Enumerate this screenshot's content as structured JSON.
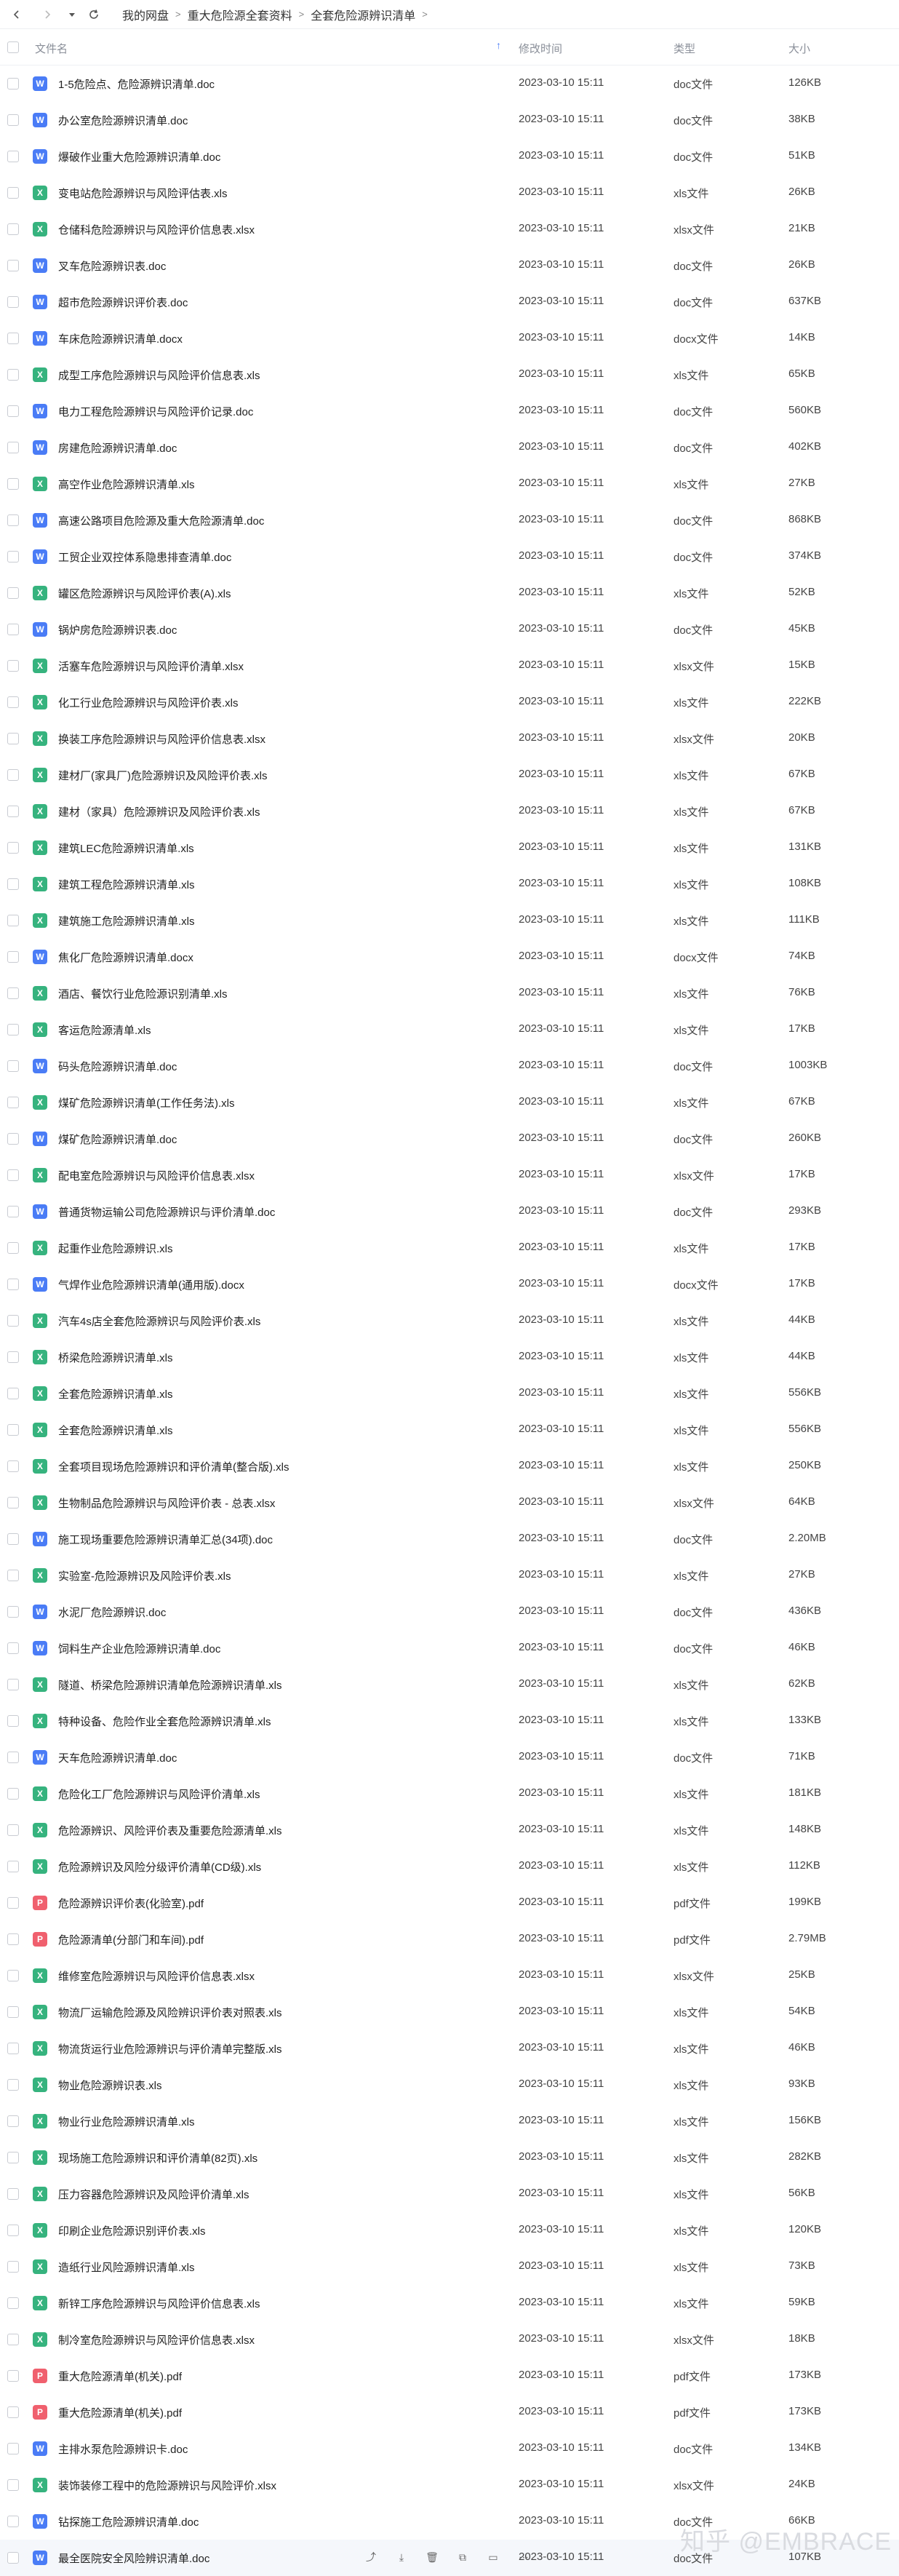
{
  "toolbar": {
    "back_icon": "chevron-left-icon",
    "forward_icon": "chevron-right-icon",
    "history_icon": "chevron-down-icon",
    "refresh_icon": "refresh-icon"
  },
  "breadcrumb": [
    "我的网盘",
    "重大危险源全套资料",
    "全套危险源辨识清单"
  ],
  "header": {
    "name": "文件名",
    "modified": "修改时间",
    "type": "类型",
    "size": "大小"
  },
  "watermark": "知乎 @EMBRACE",
  "row_action_icons": [
    "share-icon",
    "download-icon",
    "delete-icon",
    "copy-icon",
    "move-icon",
    "more-icon"
  ],
  "hovered_row": 68,
  "files": [
    {
      "name": "1-5危险点、危险源辨识清单.doc",
      "time": "2023-03-10 15:11",
      "type": "doc文件",
      "size": "126KB",
      "kind": "doc"
    },
    {
      "name": "办公室危险源辨识清单.doc",
      "time": "2023-03-10 15:11",
      "type": "doc文件",
      "size": "38KB",
      "kind": "doc"
    },
    {
      "name": "爆破作业重大危险源辨识清单.doc",
      "time": "2023-03-10 15:11",
      "type": "doc文件",
      "size": "51KB",
      "kind": "doc"
    },
    {
      "name": "变电站危险源辨识与风险评估表.xls",
      "time": "2023-03-10 15:11",
      "type": "xls文件",
      "size": "26KB",
      "kind": "xls"
    },
    {
      "name": "仓储科危险源辨识与风险评价信息表.xlsx",
      "time": "2023-03-10 15:11",
      "type": "xlsx文件",
      "size": "21KB",
      "kind": "xls"
    },
    {
      "name": "叉车危险源辨识表.doc",
      "time": "2023-03-10 15:11",
      "type": "doc文件",
      "size": "26KB",
      "kind": "doc"
    },
    {
      "name": "超市危险源辨识评价表.doc",
      "time": "2023-03-10 15:11",
      "type": "doc文件",
      "size": "637KB",
      "kind": "doc"
    },
    {
      "name": "车床危险源辨识清单.docx",
      "time": "2023-03-10 15:11",
      "type": "docx文件",
      "size": "14KB",
      "kind": "doc"
    },
    {
      "name": "成型工序危险源辨识与风险评价信息表.xls",
      "time": "2023-03-10 15:11",
      "type": "xls文件",
      "size": "65KB",
      "kind": "xls"
    },
    {
      "name": "电力工程危险源辨识与风险评价记录.doc",
      "time": "2023-03-10 15:11",
      "type": "doc文件",
      "size": "560KB",
      "kind": "doc"
    },
    {
      "name": "房建危险源辨识清单.doc",
      "time": "2023-03-10 15:11",
      "type": "doc文件",
      "size": "402KB",
      "kind": "doc"
    },
    {
      "name": "高空作业危险源辨识清单.xls",
      "time": "2023-03-10 15:11",
      "type": "xls文件",
      "size": "27KB",
      "kind": "xls"
    },
    {
      "name": "高速公路项目危险源及重大危险源清单.doc",
      "time": "2023-03-10 15:11",
      "type": "doc文件",
      "size": "868KB",
      "kind": "doc"
    },
    {
      "name": "工贸企业双控体系隐患排查清单.doc",
      "time": "2023-03-10 15:11",
      "type": "doc文件",
      "size": "374KB",
      "kind": "doc"
    },
    {
      "name": "罐区危险源辨识与风险评价表(A).xls",
      "time": "2023-03-10 15:11",
      "type": "xls文件",
      "size": "52KB",
      "kind": "xls"
    },
    {
      "name": "锅炉房危险源辨识表.doc",
      "time": "2023-03-10 15:11",
      "type": "doc文件",
      "size": "45KB",
      "kind": "doc"
    },
    {
      "name": "活塞车危险源辨识与风险评价清单.xlsx",
      "time": "2023-03-10 15:11",
      "type": "xlsx文件",
      "size": "15KB",
      "kind": "xls"
    },
    {
      "name": "化工行业危险源辨识与风险评价表.xls",
      "time": "2023-03-10 15:11",
      "type": "xls文件",
      "size": "222KB",
      "kind": "xls"
    },
    {
      "name": "换装工序危险源辨识与风险评价信息表.xlsx",
      "time": "2023-03-10 15:11",
      "type": "xlsx文件",
      "size": "20KB",
      "kind": "xls"
    },
    {
      "name": "建材厂(家具厂)危险源辨识及风险评价表.xls",
      "time": "2023-03-10 15:11",
      "type": "xls文件",
      "size": "67KB",
      "kind": "xls"
    },
    {
      "name": "建材（家具）危险源辨识及风险评价表.xls",
      "time": "2023-03-10 15:11",
      "type": "xls文件",
      "size": "67KB",
      "kind": "xls"
    },
    {
      "name": "建筑LEC危险源辨识清单.xls",
      "time": "2023-03-10 15:11",
      "type": "xls文件",
      "size": "131KB",
      "kind": "xls"
    },
    {
      "name": "建筑工程危险源辨识清单.xls",
      "time": "2023-03-10 15:11",
      "type": "xls文件",
      "size": "108KB",
      "kind": "xls"
    },
    {
      "name": "建筑施工危险源辨识清单.xls",
      "time": "2023-03-10 15:11",
      "type": "xls文件",
      "size": "111KB",
      "kind": "xls"
    },
    {
      "name": "焦化厂危险源辨识清单.docx",
      "time": "2023-03-10 15:11",
      "type": "docx文件",
      "size": "74KB",
      "kind": "doc"
    },
    {
      "name": "酒店、餐饮行业危险源识别清单.xls",
      "time": "2023-03-10 15:11",
      "type": "xls文件",
      "size": "76KB",
      "kind": "xls"
    },
    {
      "name": "客运危险源清单.xls",
      "time": "2023-03-10 15:11",
      "type": "xls文件",
      "size": "17KB",
      "kind": "xls"
    },
    {
      "name": "码头危险源辨识清单.doc",
      "time": "2023-03-10 15:11",
      "type": "doc文件",
      "size": "1003KB",
      "kind": "doc"
    },
    {
      "name": "煤矿危险源辨识清单(工作任务法).xls",
      "time": "2023-03-10 15:11",
      "type": "xls文件",
      "size": "67KB",
      "kind": "xls"
    },
    {
      "name": "煤矿危险源辨识清单.doc",
      "time": "2023-03-10 15:11",
      "type": "doc文件",
      "size": "260KB",
      "kind": "doc"
    },
    {
      "name": "配电室危险源辨识与风险评价信息表.xlsx",
      "time": "2023-03-10 15:11",
      "type": "xlsx文件",
      "size": "17KB",
      "kind": "xls"
    },
    {
      "name": "普通货物运输公司危险源辨识与评价清单.doc",
      "time": "2023-03-10 15:11",
      "type": "doc文件",
      "size": "293KB",
      "kind": "doc"
    },
    {
      "name": "起重作业危险源辨识.xls",
      "time": "2023-03-10 15:11",
      "type": "xls文件",
      "size": "17KB",
      "kind": "xls"
    },
    {
      "name": "气焊作业危险源辨识清单(通用版).docx",
      "time": "2023-03-10 15:11",
      "type": "docx文件",
      "size": "17KB",
      "kind": "doc"
    },
    {
      "name": "汽车4s店全套危险源辨识与风险评价表.xls",
      "time": "2023-03-10 15:11",
      "type": "xls文件",
      "size": "44KB",
      "kind": "xls"
    },
    {
      "name": "桥梁危险源辨识清单.xls",
      "time": "2023-03-10 15:11",
      "type": "xls文件",
      "size": "44KB",
      "kind": "xls"
    },
    {
      "name": "全套危险源辨识清单.xls",
      "time": "2023-03-10 15:11",
      "type": "xls文件",
      "size": "556KB",
      "kind": "xls"
    },
    {
      "name": "全套危险源辨识清单.xls",
      "time": "2023-03-10 15:11",
      "type": "xls文件",
      "size": "556KB",
      "kind": "xls"
    },
    {
      "name": "全套项目现场危险源辨识和评价清单(整合版).xls",
      "time": "2023-03-10 15:11",
      "type": "xls文件",
      "size": "250KB",
      "kind": "xls"
    },
    {
      "name": "生物制品危险源辨识与风险评价表 - 总表.xlsx",
      "time": "2023-03-10 15:11",
      "type": "xlsx文件",
      "size": "64KB",
      "kind": "xls"
    },
    {
      "name": "施工现场重要危险源辨识清单汇总(34项).doc",
      "time": "2023-03-10 15:11",
      "type": "doc文件",
      "size": "2.20MB",
      "kind": "doc"
    },
    {
      "name": "实验室-危险源辨识及风险评价表.xls",
      "time": "2023-03-10 15:11",
      "type": "xls文件",
      "size": "27KB",
      "kind": "xls"
    },
    {
      "name": "水泥厂危险源辨识.doc",
      "time": "2023-03-10 15:11",
      "type": "doc文件",
      "size": "436KB",
      "kind": "doc"
    },
    {
      "name": "饲料生产企业危险源辨识清单.doc",
      "time": "2023-03-10 15:11",
      "type": "doc文件",
      "size": "46KB",
      "kind": "doc"
    },
    {
      "name": "隧道、桥梁危险源辨识清单危险源辨识清单.xls",
      "time": "2023-03-10 15:11",
      "type": "xls文件",
      "size": "62KB",
      "kind": "xls"
    },
    {
      "name": "特种设备、危险作业全套危险源辨识清单.xls",
      "time": "2023-03-10 15:11",
      "type": "xls文件",
      "size": "133KB",
      "kind": "xls"
    },
    {
      "name": "天车危险源辨识清单.doc",
      "time": "2023-03-10 15:11",
      "type": "doc文件",
      "size": "71KB",
      "kind": "doc"
    },
    {
      "name": "危险化工厂危险源辨识与风险评价清单.xls",
      "time": "2023-03-10 15:11",
      "type": "xls文件",
      "size": "181KB",
      "kind": "xls"
    },
    {
      "name": "危险源辨识、风险评价表及重要危险源清单.xls",
      "time": "2023-03-10 15:11",
      "type": "xls文件",
      "size": "148KB",
      "kind": "xls"
    },
    {
      "name": "危险源辨识及风险分级评价清单(CD级).xls",
      "time": "2023-03-10 15:11",
      "type": "xls文件",
      "size": "112KB",
      "kind": "xls"
    },
    {
      "name": "危险源辨识评价表(化验室).pdf",
      "time": "2023-03-10 15:11",
      "type": "pdf文件",
      "size": "199KB",
      "kind": "pdf"
    },
    {
      "name": "危险源清单(分部门和车间).pdf",
      "time": "2023-03-10 15:11",
      "type": "pdf文件",
      "size": "2.79MB",
      "kind": "pdf"
    },
    {
      "name": "维修室危险源辨识与风险评价信息表.xlsx",
      "time": "2023-03-10 15:11",
      "type": "xlsx文件",
      "size": "25KB",
      "kind": "xls"
    },
    {
      "name": "物流厂运输危险源及风险辨识评价表对照表.xls",
      "time": "2023-03-10 15:11",
      "type": "xls文件",
      "size": "54KB",
      "kind": "xls"
    },
    {
      "name": "物流货运行业危险源辨识与评价清单完整版.xls",
      "time": "2023-03-10 15:11",
      "type": "xls文件",
      "size": "46KB",
      "kind": "xls"
    },
    {
      "name": "物业危险源辨识表.xls",
      "time": "2023-03-10 15:11",
      "type": "xls文件",
      "size": "93KB",
      "kind": "xls"
    },
    {
      "name": "物业行业危险源辨识清单.xls",
      "time": "2023-03-10 15:11",
      "type": "xls文件",
      "size": "156KB",
      "kind": "xls"
    },
    {
      "name": "现场施工危险源辨识和评价清单(82页).xls",
      "time": "2023-03-10 15:11",
      "type": "xls文件",
      "size": "282KB",
      "kind": "xls"
    },
    {
      "name": "压力容器危险源辨识及风险评价清单.xls",
      "time": "2023-03-10 15:11",
      "type": "xls文件",
      "size": "56KB",
      "kind": "xls"
    },
    {
      "name": "印刷企业危险源识别评价表.xls",
      "time": "2023-03-10 15:11",
      "type": "xls文件",
      "size": "120KB",
      "kind": "xls"
    },
    {
      "name": "造纸行业风险源辨识清单.xls",
      "time": "2023-03-10 15:11",
      "type": "xls文件",
      "size": "73KB",
      "kind": "xls"
    },
    {
      "name": "新锌工序危险源辨识与风险评价信息表.xls",
      "time": "2023-03-10 15:11",
      "type": "xls文件",
      "size": "59KB",
      "kind": "xls"
    },
    {
      "name": "制冷室危险源辨识与风险评价信息表.xlsx",
      "time": "2023-03-10 15:11",
      "type": "xlsx文件",
      "size": "18KB",
      "kind": "xls"
    },
    {
      "name": "重大危险源清单(机关).pdf",
      "time": "2023-03-10 15:11",
      "type": "pdf文件",
      "size": "173KB",
      "kind": "pdf"
    },
    {
      "name": "重大危险源清单(机关).pdf",
      "time": "2023-03-10 15:11",
      "type": "pdf文件",
      "size": "173KB",
      "kind": "pdf"
    },
    {
      "name": "主排水泵危险源辨识卡.doc",
      "time": "2023-03-10 15:11",
      "type": "doc文件",
      "size": "134KB",
      "kind": "doc"
    },
    {
      "name": "装饰装修工程中的危险源辨识与风险评价.xlsx",
      "time": "2023-03-10 15:11",
      "type": "xlsx文件",
      "size": "24KB",
      "kind": "xls"
    },
    {
      "name": "钻探施工危险源辨识清单.doc",
      "time": "2023-03-10 15:11",
      "type": "doc文件",
      "size": "66KB",
      "kind": "doc"
    },
    {
      "name": "最全医院安全风险辨识清单.doc",
      "time": "2023-03-10 15:11",
      "type": "doc文件",
      "size": "107KB",
      "kind": "doc"
    }
  ]
}
